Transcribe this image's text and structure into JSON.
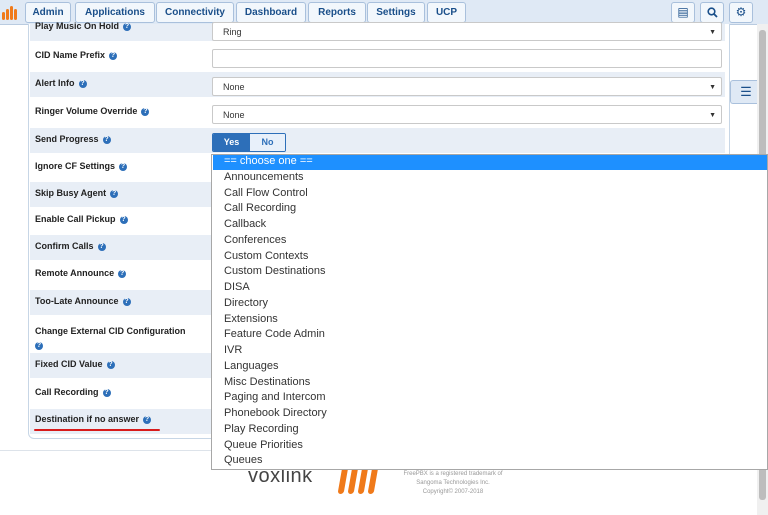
{
  "nav": {
    "tabs": [
      "Admin",
      "Applications",
      "Connectivity",
      "Dashboard",
      "Reports",
      "Settings",
      "UCP"
    ]
  },
  "form": {
    "rows": [
      {
        "label": "Play Music On Hold",
        "value": "Ring"
      },
      {
        "label": "CID Name Prefix",
        "value": ""
      },
      {
        "label": "Alert Info",
        "value": "None"
      },
      {
        "label": "Ringer Volume Override",
        "value": "None"
      },
      {
        "label": "Send Progress"
      },
      {
        "label": "Ignore CF Settings"
      },
      {
        "label": "Skip Busy Agent"
      },
      {
        "label": "Enable Call Pickup"
      },
      {
        "label": "Confirm Calls"
      },
      {
        "label": "Remote Announce"
      },
      {
        "label": "Too-Late Announce"
      },
      {
        "label": "Change External CID Configuration"
      },
      {
        "label": "Fixed CID Value"
      },
      {
        "label": "Call Recording"
      },
      {
        "label": "Destination if no answer"
      }
    ],
    "send_progress": {
      "yes": "Yes",
      "no": "No",
      "selected": "Yes"
    }
  },
  "dropdown": {
    "options": [
      "== choose one ==",
      "Announcements",
      "Call Flow Control",
      "Call Recording",
      "Callback",
      "Conferences",
      "Custom Contexts",
      "Custom Destinations",
      "DISA",
      "Directory",
      "Extensions",
      "Feature Code Admin",
      "IVR",
      "Languages",
      "Misc Destinations",
      "Paging and Intercom",
      "Phonebook Directory",
      "Play Recording",
      "Queue Priorities",
      "Queues"
    ],
    "selected_index": 0
  },
  "footer": {
    "brand": "voxlink",
    "lines": [
      "FreePBX is a registered trademark of",
      "Sangoma Technologies Inc.",
      "Copyright© 2007-2018"
    ]
  },
  "colors": {
    "accent": "#2d6fb9",
    "highlight": "#1e90ff",
    "brand_orange": "#f07a1a",
    "annotation_red": "#d81b1b"
  },
  "icons": [
    "freepbx-logo-icon",
    "language-icon",
    "search-icon",
    "gear-icon",
    "list-icon",
    "help-icon",
    "caret-down-icon"
  ]
}
